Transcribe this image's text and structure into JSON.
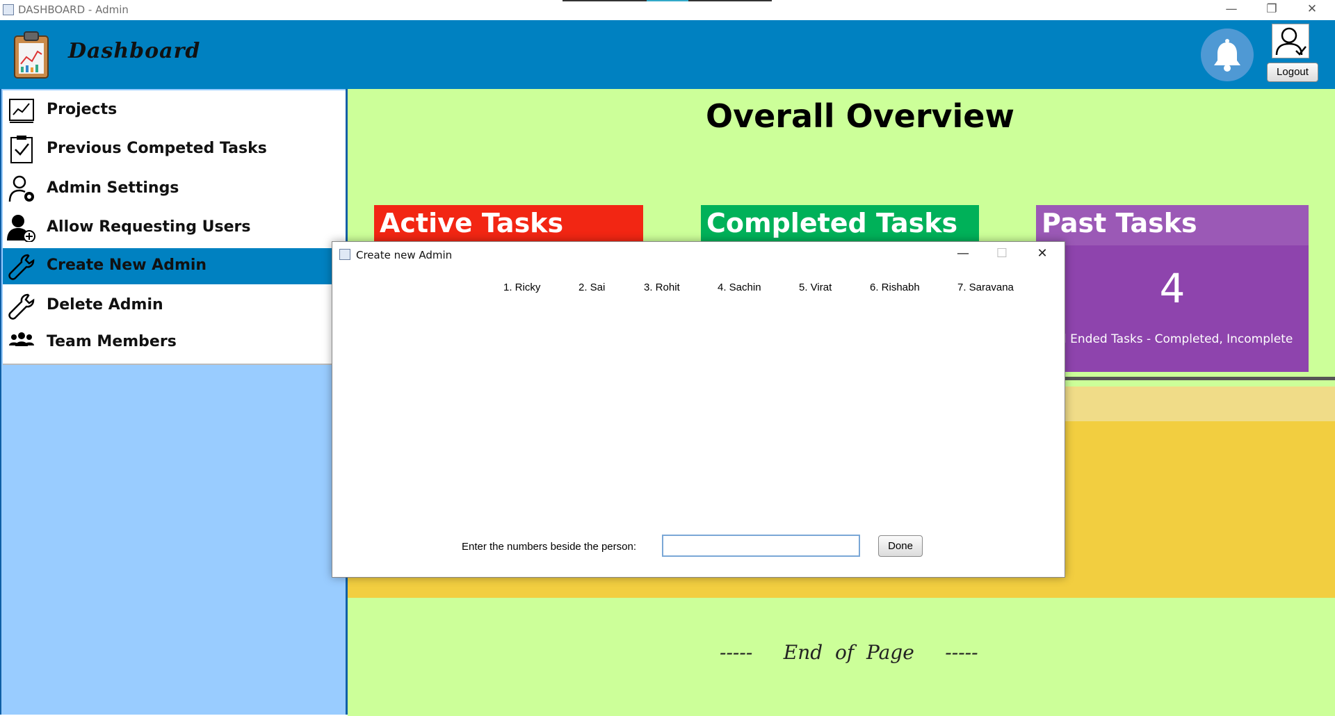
{
  "window": {
    "title": "DASHBOARD - Admin",
    "minimize": "—",
    "restore": "❐",
    "close": "✕"
  },
  "header": {
    "title": "Dashboard",
    "logout_label": "Logout",
    "logo_icon": "clipboard-chart-icon",
    "bell_icon": "bell-icon",
    "user_icon": "user-check-icon",
    "accent_color": "#0081c1"
  },
  "sidebar": {
    "items": [
      {
        "label": "Projects",
        "icon": "chart-board-icon",
        "active": false
      },
      {
        "label": "Previous Competed Tasks",
        "icon": "clipboard-check-icon",
        "active": false
      },
      {
        "label": "Admin Settings",
        "icon": "user-gear-icon",
        "active": false
      },
      {
        "label": "Allow Requesting Users",
        "icon": "user-add-icon",
        "active": false
      },
      {
        "label": "Create New Admin",
        "icon": "wrench-icon",
        "active": true
      },
      {
        "label": "Delete Admin",
        "icon": "wrench-icon",
        "active": false
      },
      {
        "label": "Team Members",
        "icon": "team-icon",
        "active": false
      }
    ]
  },
  "main": {
    "title": "Overall Overview",
    "cards": [
      {
        "title": "Active Tasks",
        "color": "#f22613"
      },
      {
        "title": "Completed Tasks",
        "color": "#00b159"
      },
      {
        "title": "Past Tasks",
        "color": "#8e44ad",
        "value": "4",
        "description": "All Ended Tasks - Completed, Incomplete"
      }
    ],
    "footer": "-----     End  of  Page     -----"
  },
  "dialog": {
    "title": "Create new Admin",
    "persons": [
      "1. Ricky",
      "2. Sai",
      "3. Rohit",
      "4. Sachin",
      "5. Virat",
      "6. Rishabh",
      "7. Saravana"
    ],
    "prompt": "Enter the numbers beside the person:",
    "input_value": "",
    "done_label": "Done",
    "minimize": "—",
    "maximize": "☐",
    "close": "✕"
  }
}
